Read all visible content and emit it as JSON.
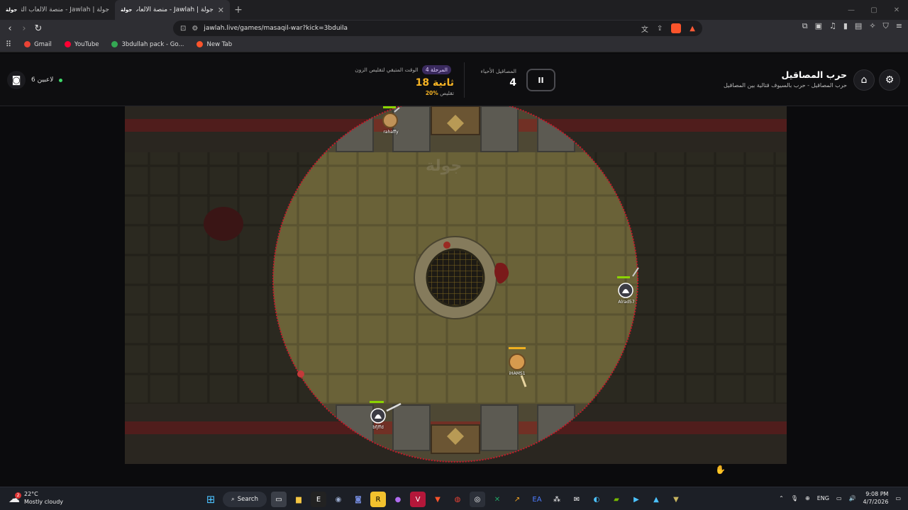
{
  "browser": {
    "tabs": [
      {
        "title": "جولة | Jawlah - منصة الألعاب التفاعلية",
        "favicon": "جولة"
      },
      {
        "title": "جولة | Jawlah - منصة الألعاب التفا",
        "favicon": "جولة"
      }
    ],
    "url": "jawlah.live/games/masaqil-war?kick=3bduila",
    "shields_count": "1",
    "bookmarks": [
      {
        "label": "Gmail",
        "color": "#ea4335"
      },
      {
        "label": "YouTube",
        "color": "#ff0033"
      },
      {
        "label": "3bdullah pack - Go...",
        "color": "#34a853"
      },
      {
        "label": "New Tab",
        "color": "#fb542b"
      }
    ]
  },
  "header": {
    "players_count": "6 لاعبين",
    "stage_badge": "المرحلة 4",
    "timer_label": "الوقت المتبقي لتقليص الزون",
    "timer_value": "18 ثانية",
    "shrink_percent": "20%",
    "shrink_label": "تقليص",
    "alive_label": "المصاقيل الأحياء",
    "alive_count": "4",
    "pause_label": "II",
    "game_title": "حرب المصاقيل",
    "game_subtitle": "حرب المصاقيل - حرب بالسيوف قتالية بين المصاقيل"
  },
  "game": {
    "watermark": "جولة",
    "zone_color": "#c41a2a",
    "players": [
      {
        "name": "rahaffy",
        "team": "gold"
      },
      {
        "name": "Alrad57",
        "team": "ghost"
      },
      {
        "name": "iHAMS1",
        "team": "gold"
      },
      {
        "name": "bfjffd",
        "team": "ghost"
      }
    ]
  },
  "taskbar": {
    "temperature": "22°C",
    "weather": "Mostly cloudy",
    "notifications": "2",
    "search_label": "Search",
    "language": "ENG",
    "time": "9:08 PM",
    "date": "4/7/2026"
  }
}
